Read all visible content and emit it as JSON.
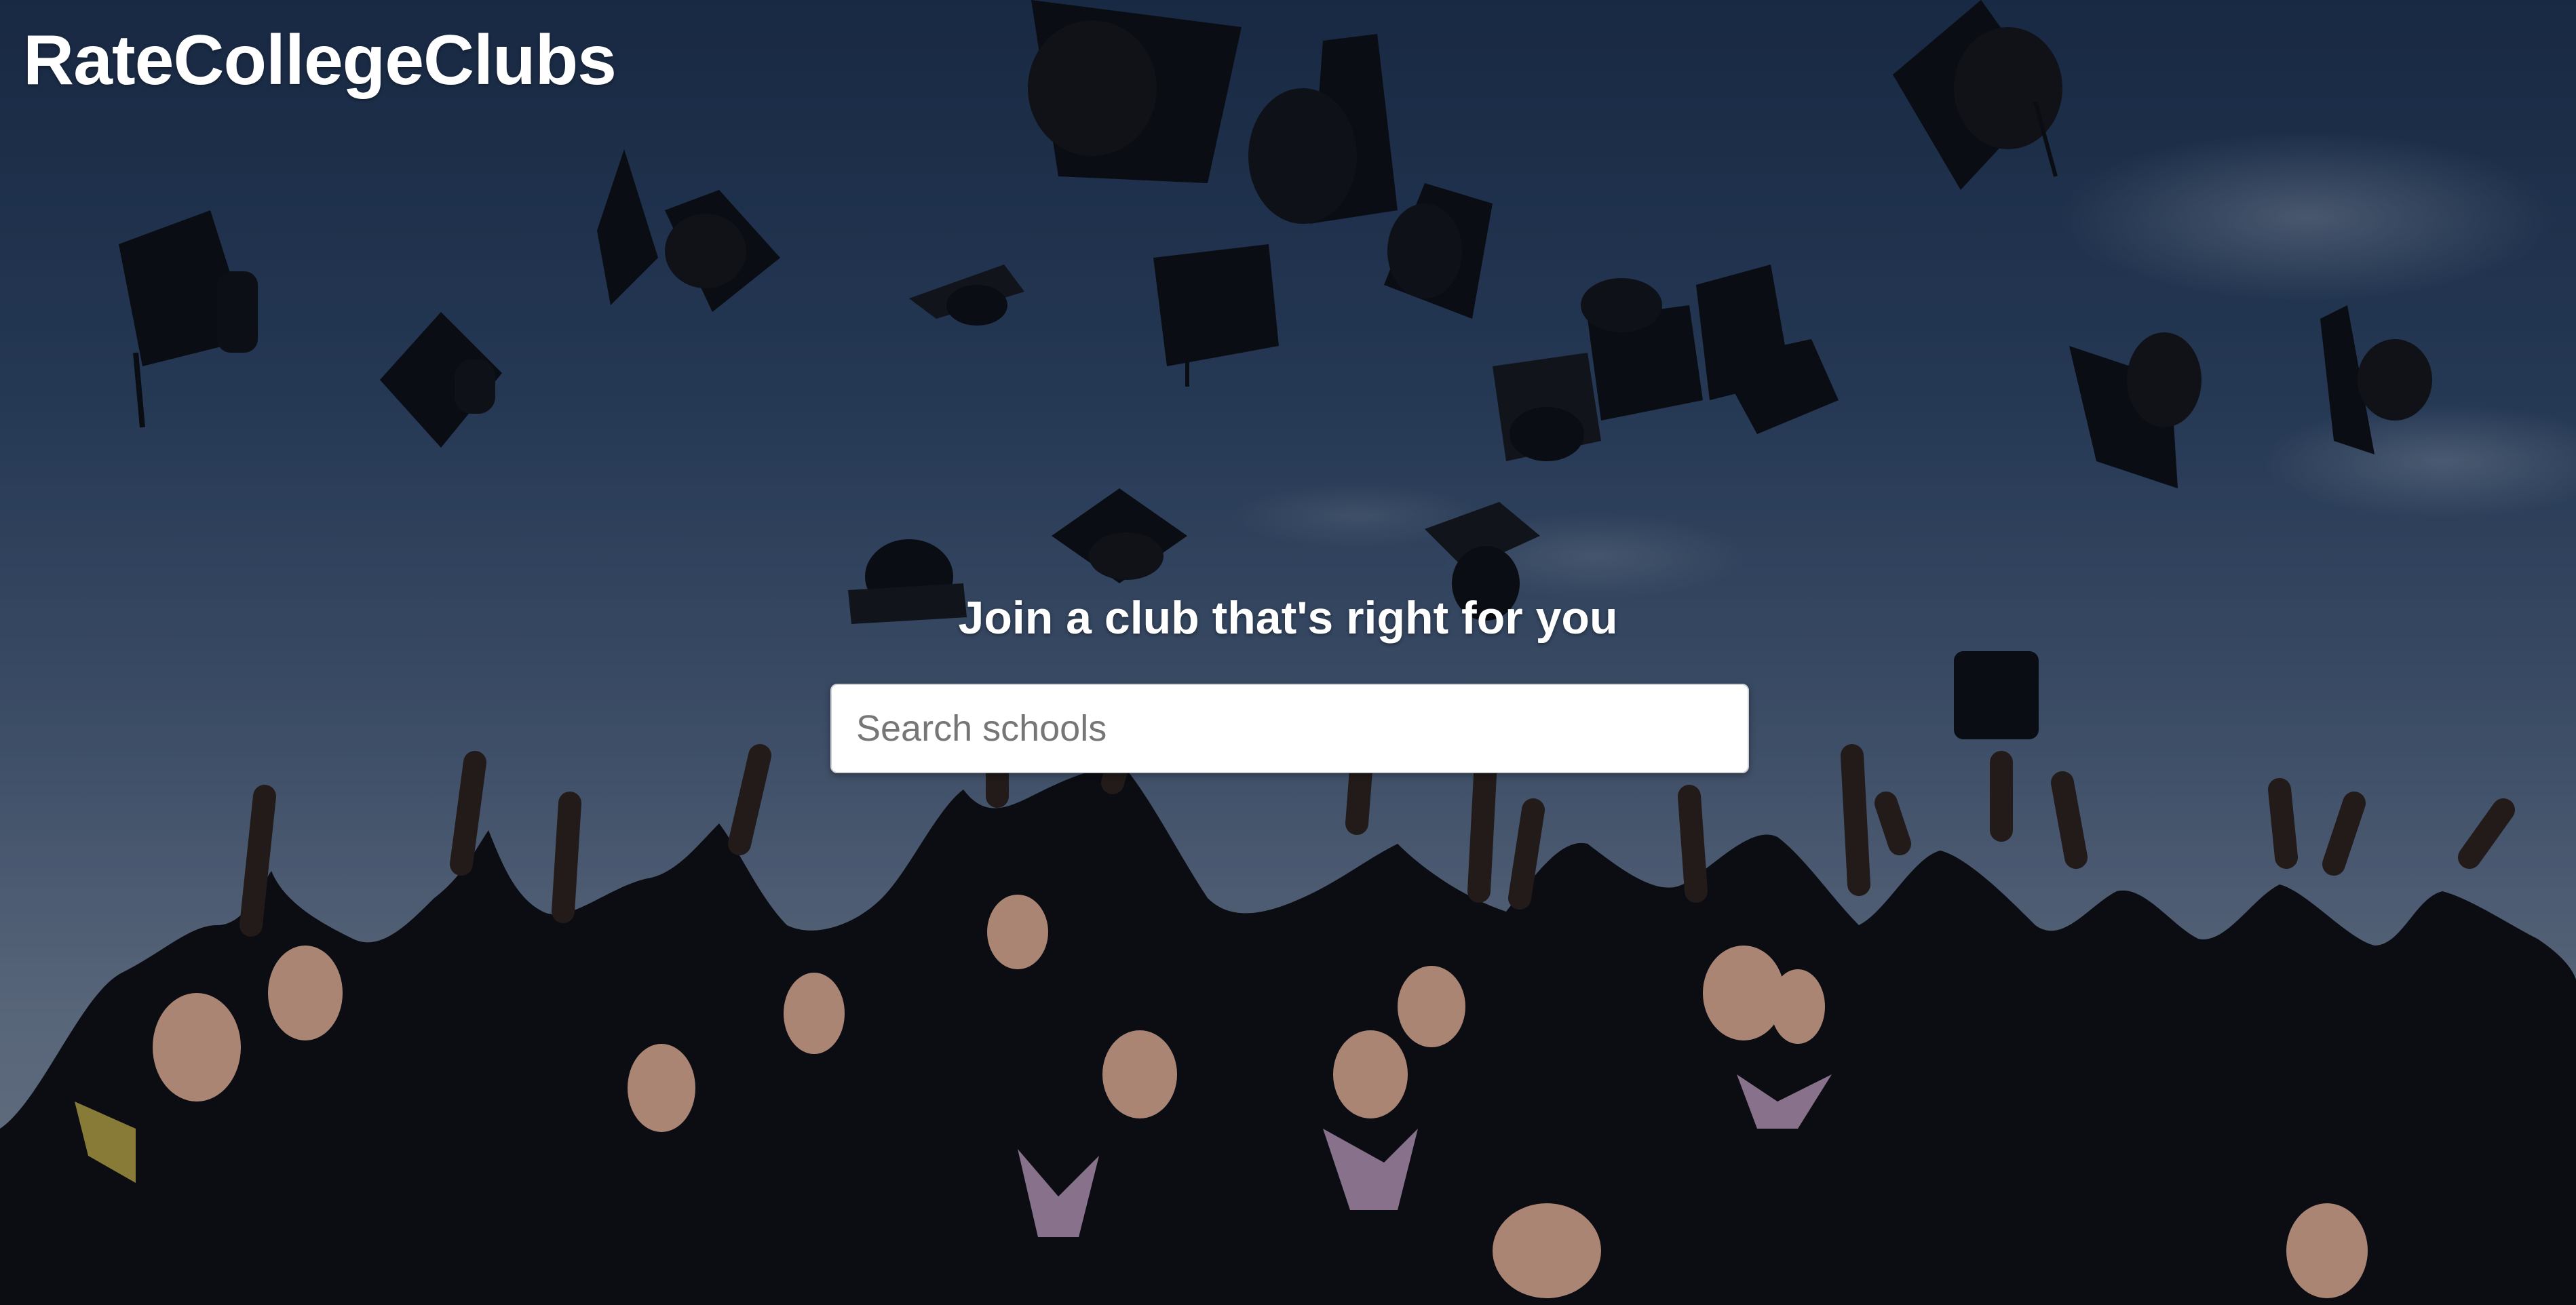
{
  "header": {
    "brand": "RateCollegeClubs"
  },
  "hero": {
    "tagline": "Join a club that's right for you",
    "background_image": "graduation-caps-thrown-in-air"
  },
  "search": {
    "placeholder": "Search schools",
    "value": ""
  },
  "colors": {
    "text": "#ffffff",
    "sky_top": "#1d3150",
    "sky_bottom": "#7f8da0",
    "input_background": "#ffffff",
    "placeholder": "#767676"
  }
}
